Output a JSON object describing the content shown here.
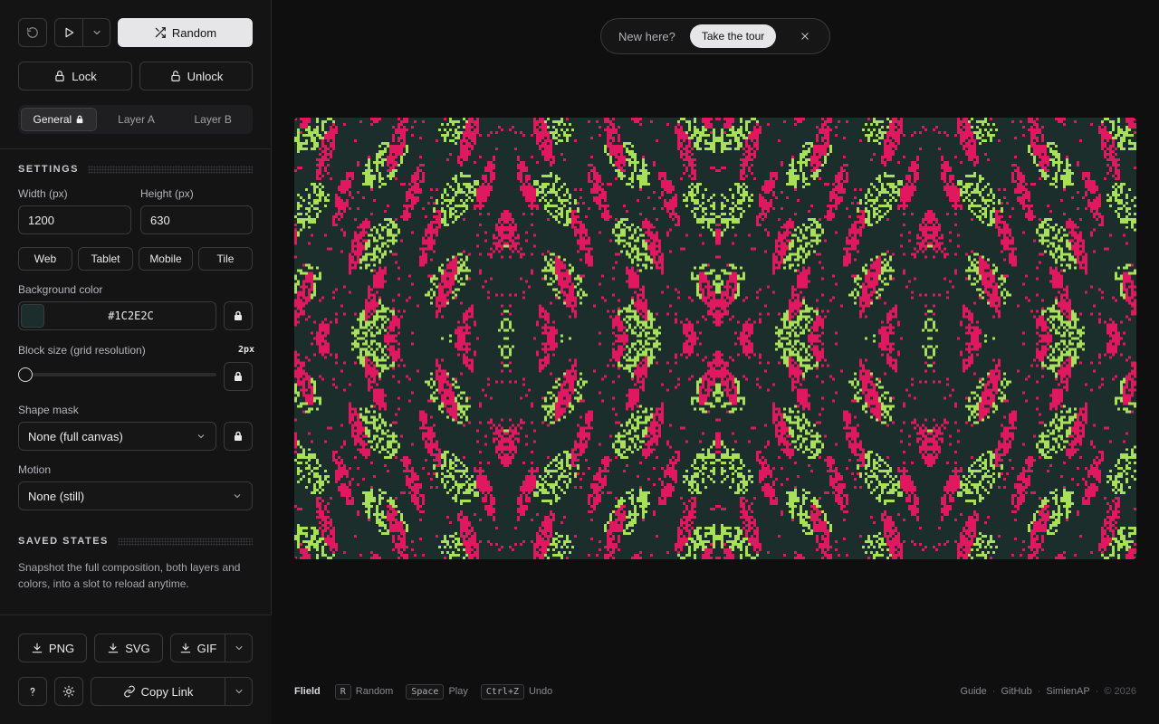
{
  "toolbar": {
    "random_label": "Random",
    "lock_label": "Lock",
    "unlock_label": "Unlock"
  },
  "tabs": [
    {
      "label": "General",
      "locked": true,
      "active": true
    },
    {
      "label": "Layer A",
      "active": false
    },
    {
      "label": "Layer B",
      "active": false
    }
  ],
  "settings": {
    "title": "SETTINGS",
    "width_label": "Width (px)",
    "width_value": "1200",
    "height_label": "Height (px)",
    "height_value": "630",
    "presets": [
      "Web",
      "Tablet",
      "Mobile",
      "Tile"
    ],
    "bg_label": "Background color",
    "bg_value": "#1C2E2C",
    "block_label": "Block size (grid resolution)",
    "block_value": "2px",
    "block_slider_fraction": 0,
    "mask_label": "Shape mask",
    "mask_value": "None (full canvas)",
    "motion_label": "Motion",
    "motion_value": "None (still)"
  },
  "saved": {
    "title": "SAVED STATES",
    "description": "Snapshot the full composition, both layers and colors, into a slot to reload anytime."
  },
  "export": {
    "png": "PNG",
    "svg": "SVG",
    "gif": "GIF",
    "copy_link": "Copy Link"
  },
  "tour": {
    "prompt": "New here?",
    "button": "Take the tour"
  },
  "footer": {
    "brand": "Flield",
    "hints": [
      {
        "key": "R",
        "label": "Random"
      },
      {
        "key": "Space",
        "label": "Play"
      },
      {
        "key": "Ctrl+Z",
        "label": "Undo"
      }
    ],
    "links": [
      "Guide",
      "GitHub",
      "SimienAP"
    ],
    "copyright": "© 2026"
  },
  "colors": {
    "background": "#1C2E2C",
    "pink": "#E0185F",
    "green": "#A8E05A"
  }
}
